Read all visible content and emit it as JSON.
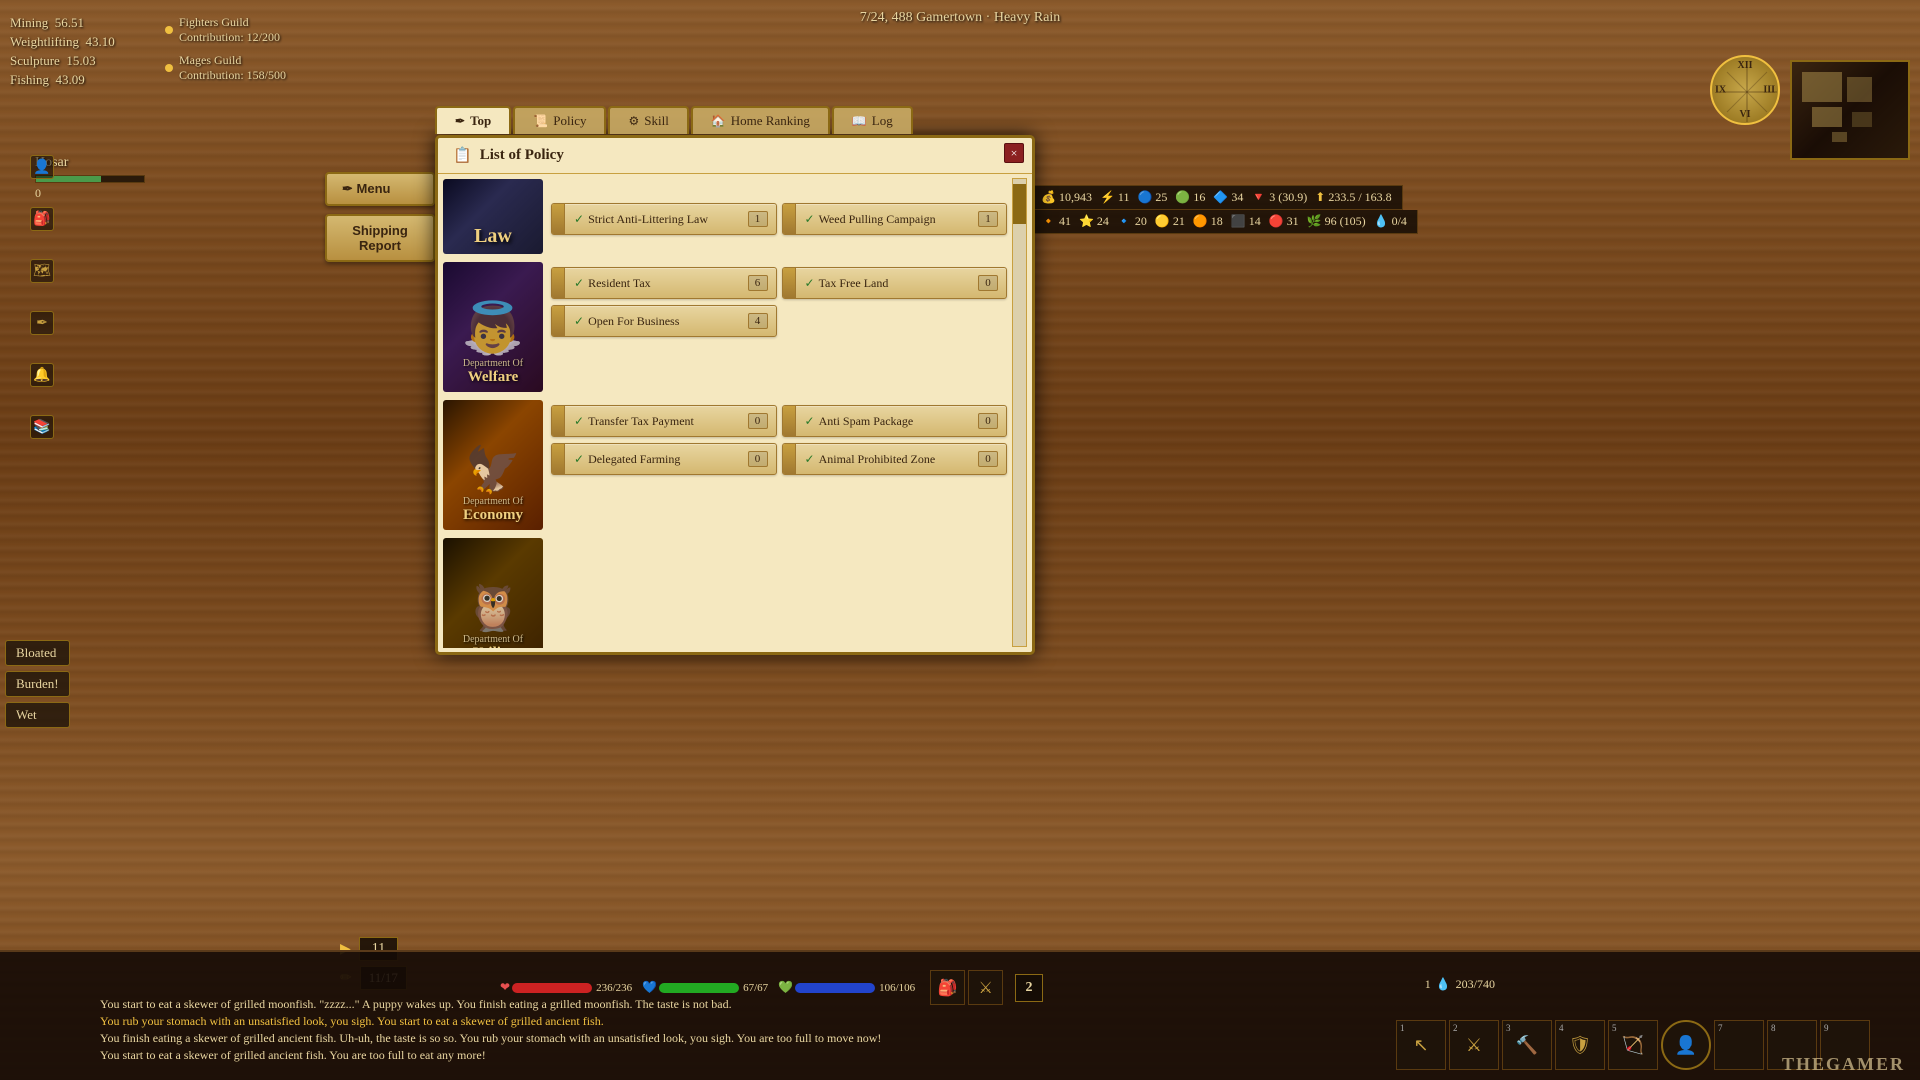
{
  "world": {
    "date": "7/24, 488",
    "location": "Gamertown",
    "weather": "Heavy Rain",
    "full": "7/24, 488 Gamertown · Heavy Rain"
  },
  "stats": {
    "mining": {
      "label": "Mining",
      "value": "56.51"
    },
    "weightlifting": {
      "label": "Weightlifting",
      "value": "43.10"
    },
    "sculpture": {
      "label": "Sculpture",
      "value": "15.03"
    },
    "fishing": {
      "label": "Fishing",
      "value": "43.09"
    }
  },
  "guilds": [
    {
      "name": "Fighters Guild",
      "contribution": "Contribution: 12/200"
    },
    {
      "name": "Mages Guild",
      "contribution": "Contribution: 158/500"
    }
  ],
  "resources": {
    "gold": "10,943",
    "r1": "11",
    "r2": "25",
    "r3": "16",
    "r4": "34",
    "r5": "3 (30.9)",
    "r6": "233.5 / 163.8",
    "r7": "41",
    "r8": "24",
    "r9": "20",
    "r10": "21",
    "r11": "18",
    "r12": "14",
    "r13": "31",
    "r14": "96 (105)",
    "r15": "0/4"
  },
  "character": {
    "name": "Hosar",
    "level": "0"
  },
  "health": {
    "hp": "236/236",
    "mp": "67/67",
    "sp": "106/106"
  },
  "dialog": {
    "title": "List of Policy",
    "title_icon": "📋",
    "close_label": "×"
  },
  "tabs": [
    {
      "label": "Top",
      "icon": "✒",
      "active": true
    },
    {
      "label": "Policy",
      "icon": "📜",
      "active": false
    },
    {
      "label": "Skill",
      "icon": "⚙",
      "active": false
    },
    {
      "label": "Home Ranking",
      "icon": "🏠",
      "active": false
    },
    {
      "label": "Log",
      "icon": "📖",
      "active": false
    }
  ],
  "departments": [
    {
      "name": "Law",
      "type": "law",
      "policies": [
        [
          {
            "name": "Strict Anti-Littering Law",
            "count": "1",
            "checked": true
          },
          {
            "name": "Weed Pulling Campaign",
            "count": "1",
            "checked": true
          }
        ]
      ]
    },
    {
      "name": "Department Of\nWelfare",
      "dept_label": "Department Of",
      "dept_name": "Welfare",
      "type": "welfare",
      "policies": [
        [
          {
            "name": "Resident Tax",
            "count": "6",
            "checked": true
          },
          {
            "name": "Tax Free Land",
            "count": "0",
            "checked": true
          }
        ],
        [
          {
            "name": "Open For Business",
            "count": "4",
            "checked": true
          },
          {
            "name": "",
            "count": "",
            "checked": false
          }
        ]
      ]
    },
    {
      "name": "Department Of\nEconomy",
      "dept_label": "Department Of",
      "dept_name": "Economy",
      "type": "economy",
      "policies": [
        [
          {
            "name": "Transfer Tax Payment",
            "count": "0",
            "checked": true
          },
          {
            "name": "Anti Spam Package",
            "count": "0",
            "checked": true
          }
        ],
        [
          {
            "name": "Delegated Farming",
            "count": "0",
            "checked": true
          },
          {
            "name": "Animal Prohibited Zone",
            "count": "0",
            "checked": true
          }
        ]
      ]
    },
    {
      "name": "Department Of\nUtility",
      "dept_label": "Department Of",
      "dept_name": "Utility",
      "type": "utility",
      "policies": []
    }
  ],
  "buttons": {
    "menu": "Menu",
    "shipping_report": "Shipping Report"
  },
  "status_badges": [
    "Bloated",
    "Burden!",
    "Wet"
  ],
  "chat_lines": [
    {
      "text": "You start to eat a skewer of grilled moonfish. \"zzzz...\" A puppy wakes up. You finish eating a grilled moonfish. The taste is not bad.",
      "yellow": false
    },
    {
      "text": "You rub your stomach with an unsatisfied look, you sigh. You start to eat a skewer of grilled ancient fish.",
      "yellow": true
    },
    {
      "text": "You finish eating a skewer of grilled ancient fish. Uh-uh, the taste is so so. You rub your stomach with an unsatisfied look, you sigh. You are too full to move now!",
      "yellow": false
    },
    {
      "text": "You start to eat a skewer of grilled ancient fish. You are too full to eat any more!",
      "yellow": false
    }
  ],
  "bottom_nums": {
    "badge1": "11",
    "badge2": "11/17",
    "page": "2",
    "res_left": "1",
    "res_right": "203/740"
  },
  "watermark": "THEGAMER"
}
